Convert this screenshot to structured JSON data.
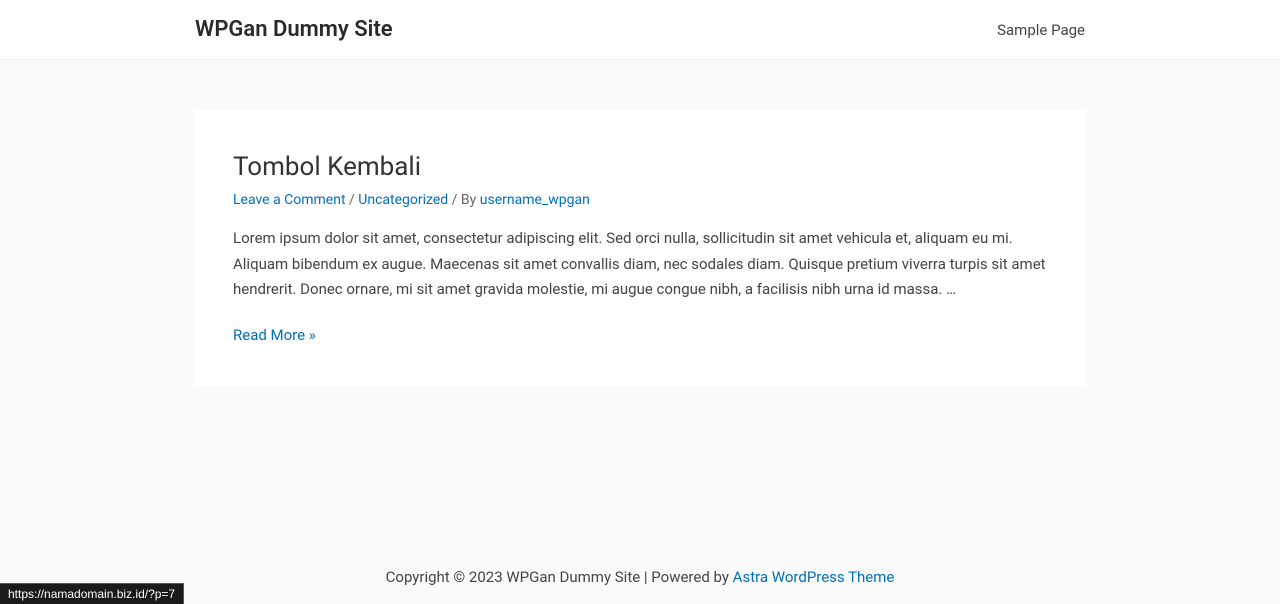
{
  "header": {
    "site_title": "WPGan Dummy Site",
    "nav_sample_page": "Sample Page"
  },
  "post": {
    "title": "Tombol Kembali",
    "leave_comment": "Leave a Comment",
    "sep1": " / ",
    "category": "Uncategorized",
    "sep2": " / By ",
    "author": "username_wpgan",
    "excerpt": "Lorem ipsum dolor sit amet, consectetur adipiscing elit. Sed orci nulla, sollicitudin sit amet vehicula et, aliquam eu mi. Aliquam bibendum ex augue. Maecenas sit amet convallis diam, nec sodales diam. Quisque pretium viverra turpis sit amet hendrerit. Donec ornare, mi sit amet gravida molestie, mi augue congue nibh, a facilisis nibh urna id massa. …",
    "read_more": "Read More »"
  },
  "footer": {
    "copyright": "Copyright © 2023 WPGan Dummy Site | Powered by ",
    "theme_link": "Astra WordPress Theme"
  },
  "statusbar": {
    "url": "https://namadomain.biz.id/?p=7"
  }
}
